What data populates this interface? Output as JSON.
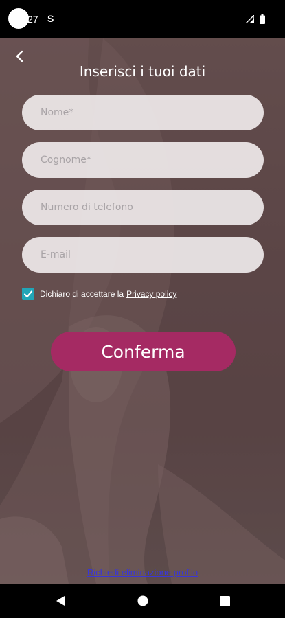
{
  "status_bar": {
    "time": "27",
    "app_indicator": "S",
    "icons": [
      "signal-icon",
      "battery-icon"
    ]
  },
  "header": {
    "back_icon": "chevron-left-icon",
    "title": "Inserisci i tuoi dati"
  },
  "form": {
    "first_name": {
      "placeholder": "Nome*",
      "value": ""
    },
    "last_name": {
      "placeholder": "Cognome*",
      "value": ""
    },
    "phone": {
      "placeholder": "Numero di telefono",
      "value": ""
    },
    "email": {
      "placeholder": "E-mail",
      "value": ""
    }
  },
  "privacy": {
    "checked": true,
    "text": "Dichiaro di accettare la",
    "link_label": "Privacy policy"
  },
  "confirm_button_label": "Conferma",
  "delete_profile_link": "Richiedi eliminazione profilo",
  "nav_bar": {
    "icons": [
      "nav-back-icon",
      "nav-home-icon",
      "nav-recents-icon"
    ]
  },
  "colors": {
    "accent_button": "#a52a63",
    "checkbox": "#21a5b7",
    "link": "#3a36d6"
  }
}
